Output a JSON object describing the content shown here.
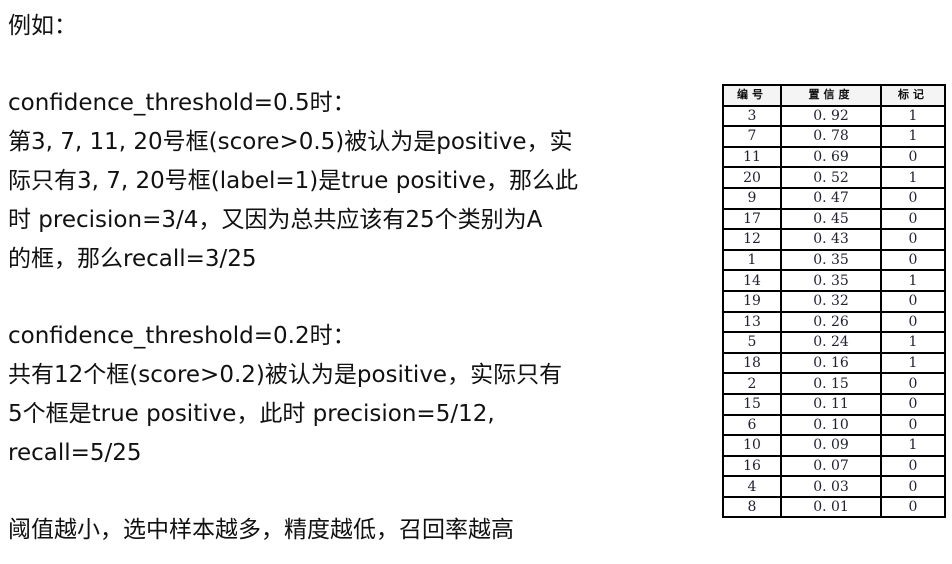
{
  "lines": [
    "例如：",
    "confidence_threshold=0.5时：",
    "第3, 7, 11, 20号框(score>0.5)被认为是positive，实",
    "际只有3, 7, 20号框(label=1)是true positive，那么此",
    "时 precision=3/4，又因为总共应该有25个类别为A",
    "的框，那么recall=3/25",
    "confidence_threshold=0.2时：",
    "共有12个框(score>0.2)被认为是positive，实际只有",
    "5个框是true positive，此时 precision=5/12,",
    "recall=5/25",
    "阈值越小，选中样本越多，精度越低，召回率越高"
  ],
  "table": {
    "headers": [
      "编号",
      "置信度",
      "标记"
    ],
    "rows": [
      [
        "3",
        "0. 92",
        "1"
      ],
      [
        "7",
        "0. 78",
        "1"
      ],
      [
        "11",
        "0. 69",
        "0"
      ],
      [
        "20",
        "0. 52",
        "1"
      ],
      [
        "9",
        "0. 47",
        "0"
      ],
      [
        "17",
        "0. 45",
        "0"
      ],
      [
        "12",
        "0. 43",
        "0"
      ],
      [
        "1",
        "0. 35",
        "0"
      ],
      [
        "14",
        "0. 35",
        "1"
      ],
      [
        "19",
        "0. 32",
        "0"
      ],
      [
        "13",
        "0. 26",
        "0"
      ],
      [
        "5",
        "0. 24",
        "1"
      ],
      [
        "18",
        "0. 16",
        "1"
      ],
      [
        "2",
        "0. 15",
        "0"
      ],
      [
        "15",
        "0. 11",
        "0"
      ],
      [
        "6",
        "0. 10",
        "0"
      ],
      [
        "10",
        "0. 09",
        "1"
      ],
      [
        "16",
        "0. 07",
        "0"
      ],
      [
        "4",
        "0. 03",
        "0"
      ],
      [
        "8",
        "0. 01",
        "0"
      ]
    ]
  }
}
